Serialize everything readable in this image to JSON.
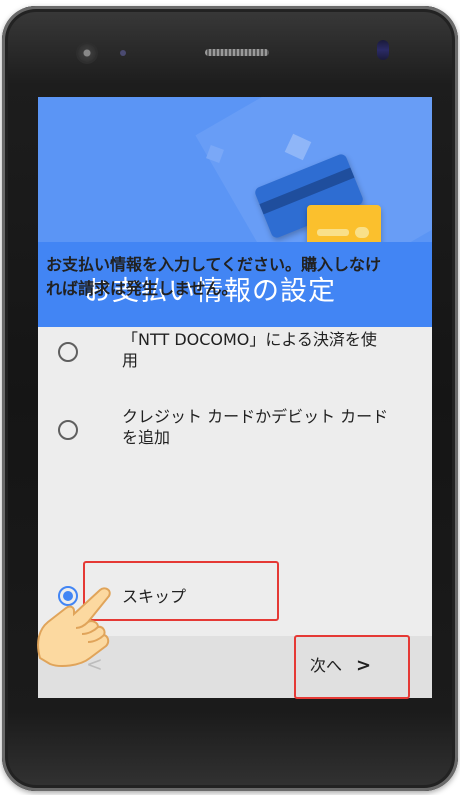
{
  "hero": {
    "title": "お支払い情報の設定"
  },
  "description": "お支払い情報を入力してください。購入しなければ請求は発生しません。",
  "options": [
    {
      "label": "「NTT DOCOMO」による決済を使用",
      "selected": false
    },
    {
      "label": "クレジット カードかデビット カードを追加",
      "selected": false
    },
    {
      "label": "スキップ",
      "selected": true
    }
  ],
  "nav": {
    "back": "<",
    "next": "次へ",
    "next_chevron": ">"
  },
  "colors": {
    "accent": "#4285f4",
    "highlight": "#e53935",
    "card_yellow": "#fbc02d"
  },
  "icons": {
    "hand": "pointing-hand-icon",
    "card_blue": "credit-card-icon",
    "card_yellow": "credit-card-icon"
  }
}
